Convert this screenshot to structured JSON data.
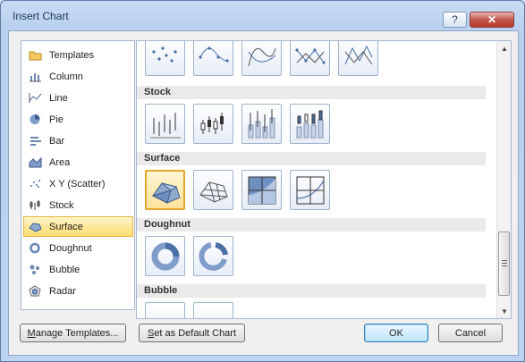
{
  "window": {
    "title": "Insert Chart",
    "help_label": "?",
    "close_label": "✕"
  },
  "left_nav": [
    {
      "label": "Templates",
      "icon": "folder-icon"
    },
    {
      "label": "Column",
      "icon": "column-chart-icon"
    },
    {
      "label": "Line",
      "icon": "line-chart-icon"
    },
    {
      "label": "Pie",
      "icon": "pie-chart-icon"
    },
    {
      "label": "Bar",
      "icon": "bar-chart-icon"
    },
    {
      "label": "Area",
      "icon": "area-chart-icon"
    },
    {
      "label": "X Y (Scatter)",
      "icon": "scatter-chart-icon"
    },
    {
      "label": "Stock",
      "icon": "stock-chart-icon"
    },
    {
      "label": "Surface",
      "icon": "surface-chart-icon",
      "selected": true
    },
    {
      "label": "Doughnut",
      "icon": "doughnut-chart-icon"
    },
    {
      "label": "Bubble",
      "icon": "bubble-chart-icon"
    },
    {
      "label": "Radar",
      "icon": "radar-chart-icon"
    }
  ],
  "gallery": {
    "sections": [
      {
        "title": "Stock",
        "tiles": 4
      },
      {
        "title": "Surface",
        "tiles": 4
      },
      {
        "title": "Doughnut",
        "tiles": 2
      },
      {
        "title": "Bubble",
        "tiles": 2
      }
    ],
    "scatter_tiles_visible": 5
  },
  "footer": {
    "manage_templates": {
      "prefix": "",
      "underline": "M",
      "rest": "anage Templates..."
    },
    "set_default": {
      "underline": "S",
      "rest": "et as Default Chart"
    },
    "ok": "OK",
    "cancel": "Cancel"
  },
  "colors": {
    "selection": "#ffdd73",
    "accent": "#4a6fa5"
  }
}
